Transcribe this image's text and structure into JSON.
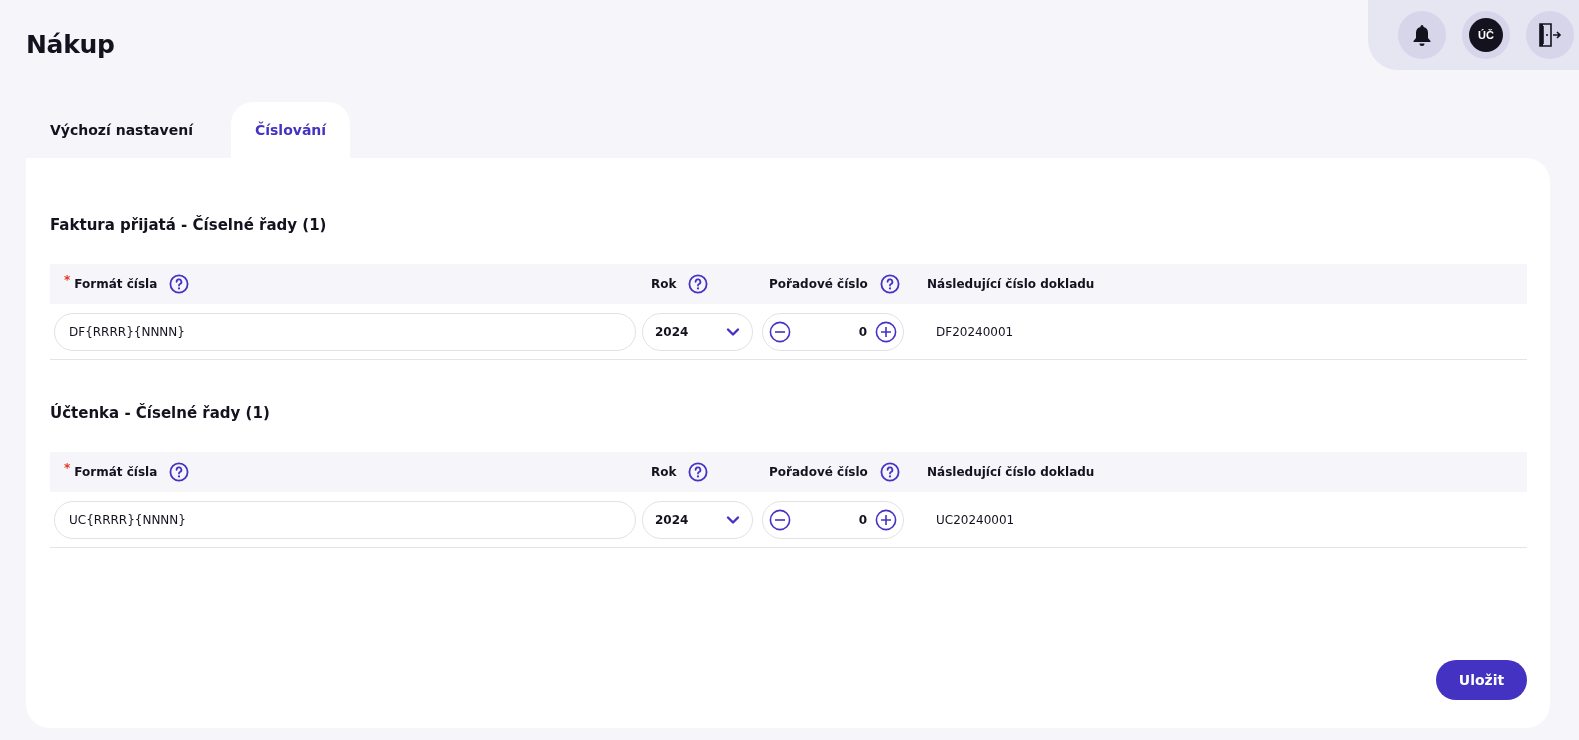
{
  "page_title": "Nákup",
  "header": {
    "avatar": "ÚČ"
  },
  "tabs": [
    {
      "label": "Výchozí nastavení",
      "selected": false
    },
    {
      "label": "Číslování",
      "selected": true
    }
  ],
  "sections": [
    {
      "title": "Faktura přijatá - Číselné řady (1)",
      "columns": [
        {
          "required_mark": "*",
          "label": "Formát čísla",
          "help": true
        },
        {
          "label": "Rok",
          "help": true
        },
        {
          "label": "Pořadové číslo",
          "help": true
        },
        {
          "label": "Následující číslo dokladu",
          "help": false
        }
      ],
      "rows": [
        {
          "format": "DF{RRRR}{NNNN}",
          "year": "2024",
          "sequence": "0",
          "next": "DF20240001"
        }
      ]
    },
    {
      "title": "Účtenka - Číselné řady (1)",
      "columns": [
        {
          "required_mark": "*",
          "label": "Formát čísla",
          "help": true
        },
        {
          "label": "Rok",
          "help": true
        },
        {
          "label": "Pořadové číslo",
          "help": true
        },
        {
          "label": "Následující číslo dokladu",
          "help": false
        }
      ],
      "rows": [
        {
          "format": "UC{RRRR}{NNNN}",
          "year": "2024",
          "sequence": "0",
          "next": "UC20240001"
        }
      ]
    }
  ],
  "save_button": "Uložit"
}
